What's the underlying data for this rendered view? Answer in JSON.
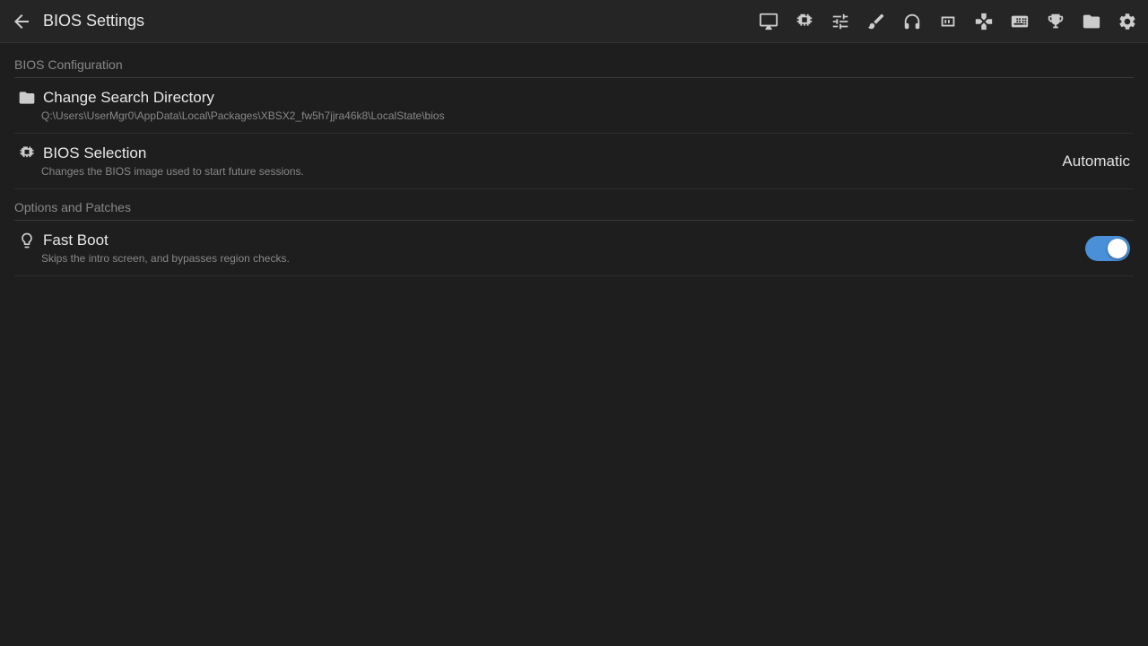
{
  "header": {
    "back_label": "←",
    "title": "BIOS Settings",
    "icons": [
      {
        "name": "display-icon",
        "symbol": "▭"
      },
      {
        "name": "chip-icon",
        "symbol": "▦"
      },
      {
        "name": "sliders-icon",
        "symbol": "≡"
      },
      {
        "name": "pen-icon",
        "symbol": "✎"
      },
      {
        "name": "headphones-icon",
        "symbol": "🎧"
      },
      {
        "name": "memory-icon",
        "symbol": "▣"
      },
      {
        "name": "gamepad-icon",
        "symbol": "⊛"
      },
      {
        "name": "keyboard-icon",
        "symbol": "⌨"
      },
      {
        "name": "trophy-icon",
        "symbol": "🏆"
      },
      {
        "name": "folder-icon",
        "symbol": "📁"
      },
      {
        "name": "gear-icon",
        "symbol": "⚙"
      }
    ]
  },
  "sections": [
    {
      "id": "bios-configuration",
      "label": "BIOS Configuration",
      "items": [
        {
          "id": "change-search-directory",
          "icon": "folder",
          "title": "Change Search Directory",
          "subtitle": "Q:\\Users\\UserMgr0\\AppData\\Local\\Packages\\XBSX2_fw5h7jjra46k8\\LocalState\\bios",
          "value": "",
          "type": "action"
        },
        {
          "id": "bios-selection",
          "icon": "chip",
          "title": "BIOS Selection",
          "subtitle": "Changes the BIOS image used to start future sessions.",
          "value": "Automatic",
          "type": "select"
        }
      ]
    },
    {
      "id": "options-and-patches",
      "label": "Options and Patches",
      "items": [
        {
          "id": "fast-boot",
          "icon": "bulb",
          "title": "Fast Boot",
          "subtitle": "Skips the intro screen, and bypasses region checks.",
          "value": true,
          "type": "toggle"
        }
      ]
    }
  ]
}
